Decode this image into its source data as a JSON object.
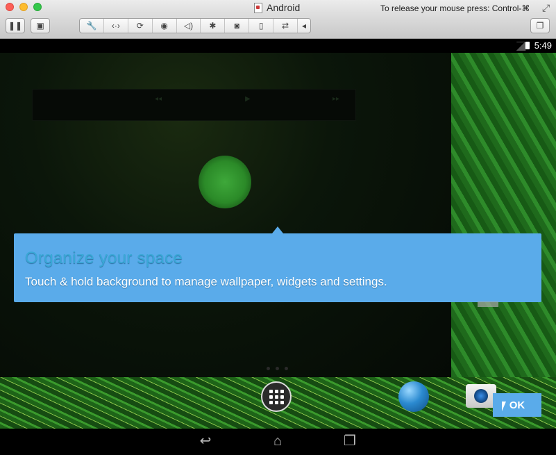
{
  "window": {
    "title": "Android",
    "release_hint": "To release your mouse press: Control-⌘"
  },
  "toolbar": {
    "icons": [
      "pause-icon",
      "screenshot-icon",
      "wrench-icon",
      "arrows-icon",
      "rotate-icon",
      "gps-icon",
      "volume-icon",
      "bluetooth-icon",
      "camera-icon",
      "mouse-icon",
      "refresh-icon",
      "collapse-icon",
      "windows-icon"
    ]
  },
  "status": {
    "time": "5:49"
  },
  "cling": {
    "title": "Organize your space",
    "body": "Touch & hold background to manage wallpaper, widgets and settings.",
    "ok_label": "OK",
    "color": "#5aabea"
  },
  "nav": {
    "back": "back-icon",
    "home": "home-icon",
    "recents": "recents-icon"
  }
}
